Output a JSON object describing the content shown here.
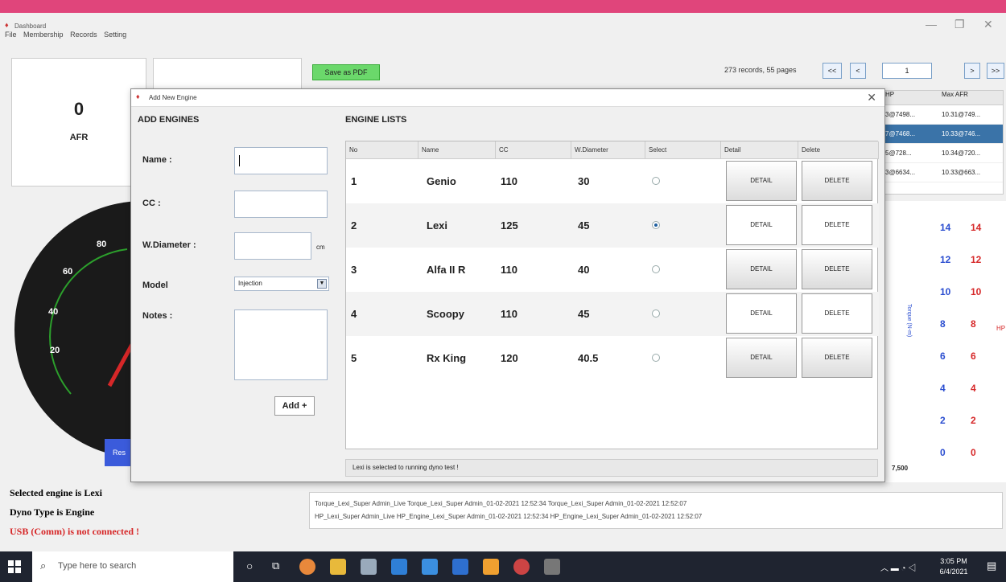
{
  "app": {
    "window_title": "Dashboard",
    "menu": [
      "File",
      "Membership",
      "Records",
      "Setting"
    ],
    "afr_value": "0",
    "afr_label": "AFR",
    "save_pdf_label": "Save as PDF",
    "pager_info": "273 records, 55 pages",
    "pager_buttons": [
      "<<",
      "<",
      "1",
      ">",
      ">>"
    ],
    "records_table": {
      "headers": [
        "HP",
        "Max AFR"
      ],
      "rows": [
        [
          "3@7498...",
          "10.31@749..."
        ],
        [
          "7@7468...",
          "10.33@746..."
        ],
        [
          "5@728...",
          "10.34@720..."
        ],
        [
          "3@6634...",
          "10.33@663..."
        ]
      ],
      "selected_row": 1
    },
    "gauge_ticks": [
      "80",
      "60",
      "40",
      "20"
    ],
    "chart_axis_left": [
      "14",
      "12",
      "10",
      "8",
      "6",
      "4",
      "2",
      "0"
    ],
    "chart_axis_right": [
      "14",
      "12",
      "10",
      "8",
      "6",
      "4",
      "2",
      "0"
    ],
    "chart_axis_left_title": "Torque (N-m)",
    "chart_axis_right_title": "HP",
    "chart_x_tick": "7,500",
    "reset_label": "Res",
    "status_lines": [
      "Selected engine is Lexi",
      "Dyno Type is Engine",
      "USB (Comm) is not connected !"
    ],
    "legend_lines": [
      "Torque_Lexi_Super Admin_Live  Torque_Lexi_Super Admin_01-02-2021 12:52:34  Torque_Lexi_Super Admin_01-02-2021 12:52:07",
      "HP_Lexi_Super Admin_Live  HP_Engine_Lexi_Super Admin_01-02-2021 12:52:34  HP_Engine_Lexi_Super Admin_01-02-2021 12:52:07"
    ]
  },
  "dialog": {
    "title": "Add New Engine",
    "add_section_title": "ADD ENGINES",
    "list_section_title": "ENGINE LISTS",
    "form": {
      "name_label": "Name :",
      "cc_label": "CC :",
      "wdiameter_label": "W.Diameter :",
      "wdiameter_unit": "cm",
      "model_label": "Model",
      "model_value": "Injection",
      "notes_label": "Notes :",
      "add_button": "Add +"
    },
    "table": {
      "headers": [
        "No",
        "Name",
        "CC",
        "W.Diameter",
        "Select",
        "Detail",
        "Delete"
      ],
      "rows": [
        {
          "no": "1",
          "name": "Genio",
          "cc": "110",
          "wd": "30",
          "selected": false,
          "detail": "DETAIL",
          "delete": "DELETE"
        },
        {
          "no": "2",
          "name": "Lexi",
          "cc": "125",
          "wd": "45",
          "selected": true,
          "detail": "DETAIL",
          "delete": "DELETE"
        },
        {
          "no": "3",
          "name": "Alfa II R",
          "cc": "110",
          "wd": "40",
          "selected": false,
          "detail": "DETAIL",
          "delete": "DELETE"
        },
        {
          "no": "4",
          "name": "Scoopy",
          "cc": "110",
          "wd": "45",
          "selected": false,
          "detail": "DETAIL",
          "delete": "DELETE"
        },
        {
          "no": "5",
          "name": "Rx King",
          "cc": "120",
          "wd": "40.5",
          "selected": false,
          "detail": "DETAIL",
          "delete": "DELETE"
        }
      ]
    },
    "status": "Lexi is selected to running dyno test !"
  },
  "taskbar": {
    "search_placeholder": "Type here to search",
    "time": "3:05 PM",
    "date": "6/4/2021"
  }
}
